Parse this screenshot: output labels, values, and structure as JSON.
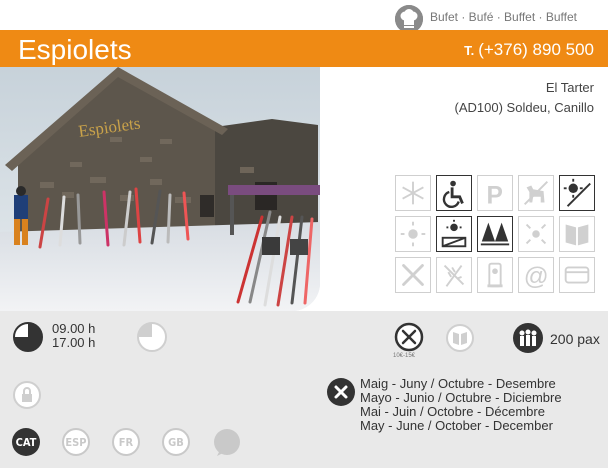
{
  "header": {
    "category_text": "Bufet · Bufé · Buffet · Buffet",
    "title": "Espiolets",
    "phone_label": "T.",
    "phone_number": "(+376) 890 500"
  },
  "address": {
    "line1": "El Tarter",
    "line2": "(AD100) Soldeu, Canillo"
  },
  "photo": {
    "sign_text": "Espiolets"
  },
  "services": [
    {
      "name": "snowflake-icon",
      "active": false
    },
    {
      "name": "wheelchair-icon",
      "active": true
    },
    {
      "name": "parking-icon",
      "active": false
    },
    {
      "name": "pets-icon",
      "active": false
    },
    {
      "name": "sun-no-icon",
      "active": true
    },
    {
      "name": "sun-outline-icon",
      "active": false
    },
    {
      "name": "terrace-sun-icon",
      "active": true
    },
    {
      "name": "forest-icon",
      "active": true
    },
    {
      "name": "sun-inside-icon",
      "active": false
    },
    {
      "name": "menu-book-icon",
      "active": false
    },
    {
      "name": "cutlery-icon",
      "active": false
    },
    {
      "name": "wheat-icon",
      "active": false
    },
    {
      "name": "vending-icon",
      "active": false
    },
    {
      "name": "at-sign-icon",
      "active": false
    },
    {
      "name": "credit-card-icon",
      "active": false
    }
  ],
  "hours": {
    "open": "09.00 h",
    "close": "17.00 h"
  },
  "menu_price": "10€-15€",
  "capacity": "200 pax",
  "season": {
    "ca": "Maig - Juny / Octubre - Desembre",
    "es": "Mayo - Junio / Octubre - Diciembre",
    "fr": "Mai - Juin / Octobre - Décembre",
    "en": "May - June / October - December"
  },
  "languages": [
    {
      "code": "CAT",
      "active": true
    },
    {
      "code": "ESP",
      "active": false
    },
    {
      "code": "FR",
      "active": false
    },
    {
      "code": "GB",
      "active": false
    }
  ],
  "colors": {
    "accent": "#ef8a14",
    "dark": "#333333",
    "inactive": "#c9c9c9",
    "band": "#e9e9e9"
  }
}
